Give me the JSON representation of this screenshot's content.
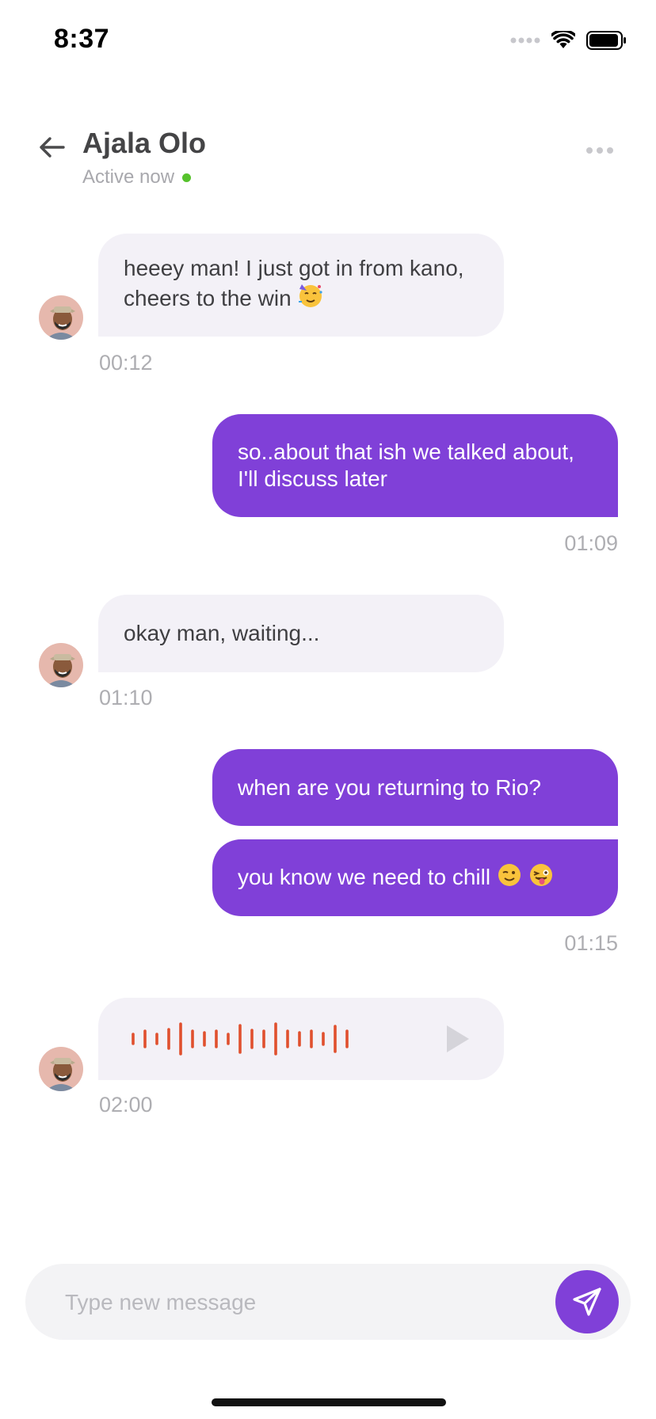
{
  "status_bar": {
    "time": "8:37"
  },
  "header": {
    "contact_name": "Ajala Olo",
    "presence": "Active now",
    "presence_color": "#56c22c"
  },
  "messages": [
    {
      "direction": "incoming",
      "text_line1": "heeey man! I just got in from kano,",
      "text_line2": "cheers to the win",
      "emoji": "partying-face",
      "time": "00:12"
    },
    {
      "direction": "outgoing",
      "text_line1": "so..about that ish we talked about,",
      "text_line2": "I'll discuss later",
      "time": "01:09"
    },
    {
      "direction": "incoming",
      "text": "okay man, waiting...",
      "time": "01:10"
    },
    {
      "direction": "outgoing",
      "text": "when are you returning to Rio?"
    },
    {
      "direction": "outgoing",
      "text": "you know we need to chill",
      "emojis": [
        "winking-face",
        "winking-face-with-tongue"
      ],
      "time": "01:15"
    },
    {
      "direction": "incoming",
      "type": "voice-note",
      "time": "02:00"
    }
  ],
  "composer": {
    "placeholder": "Type new message"
  },
  "colors": {
    "accent": "#8040d8",
    "incoming_bubble": "#f3f1f7",
    "waveform": "#e0502e",
    "timestamp": "#aeaeb2"
  }
}
